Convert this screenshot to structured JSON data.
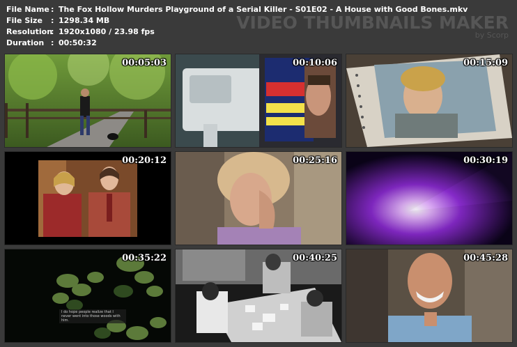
{
  "info": {
    "rows": [
      {
        "label": "File Name",
        "value": "The Fox Hollow Murders Playground of a Serial Killer - S01E02 - A House with Good Bones.mkv"
      },
      {
        "label": "File Size",
        "value": "1298.34 MB"
      },
      {
        "label": "Resolution",
        "value": "1920x1080 / 23.98 fps"
      },
      {
        "label": "Duration",
        "value": "00:50:32"
      }
    ],
    "separator": ":"
  },
  "brand": {
    "title": "VIDEO THUMBNAILS MAKER",
    "subtitle": "by Scorp"
  },
  "thumbnails": [
    {
      "timestamp": "00:05:03",
      "scene": "jogger-with-dog-on-path"
    },
    {
      "timestamp": "00:10:06",
      "scene": "microfiche-reader-and-tabloid"
    },
    {
      "timestamp": "00:15:09",
      "scene": "photo-album-boy-portrait"
    },
    {
      "timestamp": "00:20:12",
      "scene": "vintage-couple-photo"
    },
    {
      "timestamp": "00:25:16",
      "scene": "woman-hand-on-face"
    },
    {
      "timestamp": "00:30:19",
      "scene": "projector-light-purple"
    },
    {
      "timestamp": "00:35:22",
      "scene": "dark-leaves-with-subtitle",
      "subtitle": "I do hope people realize that I never went into those woods with him."
    },
    {
      "timestamp": "00:40:25",
      "scene": "black-and-white-interrogation-table"
    },
    {
      "timestamp": "00:45:28",
      "scene": "smiling-man-interview"
    }
  ]
}
